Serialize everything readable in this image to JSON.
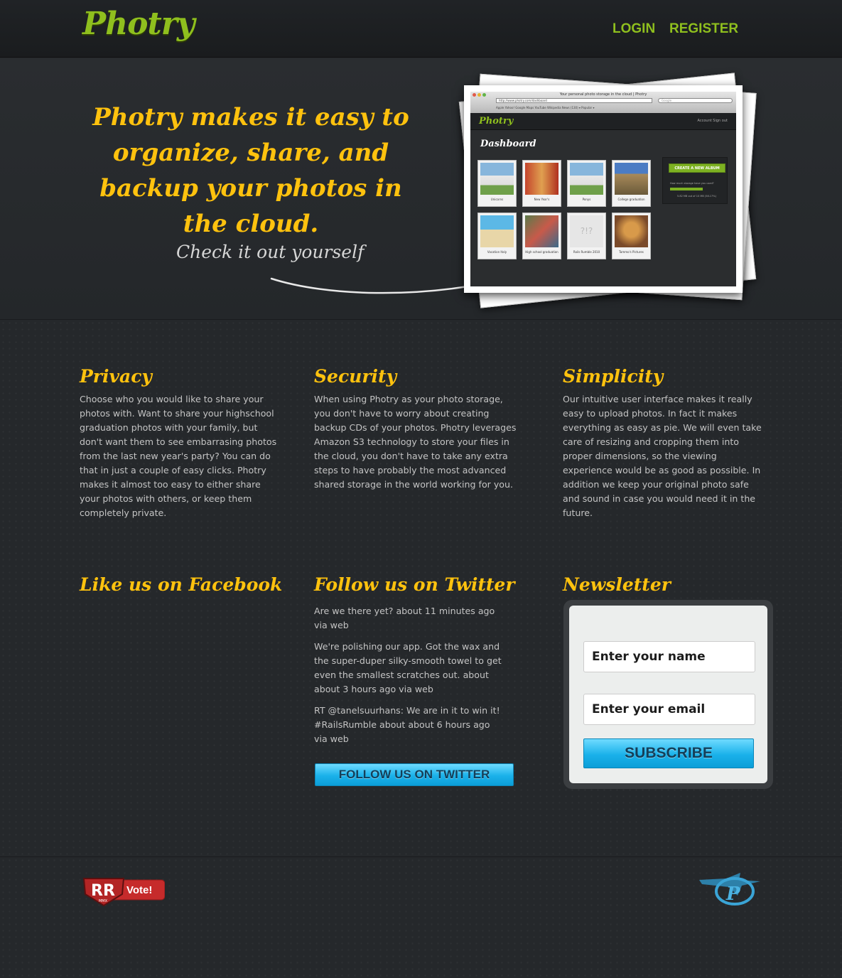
{
  "header": {
    "logo": "Photry",
    "nav": {
      "login": "LOGIN",
      "register": "REGISTER"
    }
  },
  "hero": {
    "tagline": "Photry makes it easy to organize, share, and backup your photos in the cloud.",
    "cta": "Check it out yourself",
    "screenshot": {
      "window_title": "Your personal photo storage in the cloud | Photry",
      "url": "http://www.photry.com/dashboard",
      "search_placeholder": "Google",
      "bookmarks": "Apple   Yahoo!   Google Maps   YouTube   Wikipedia   News (130) ▾   Popular ▾",
      "logo": "Photry",
      "account": "Account    Sign out",
      "heading": "Dashboard",
      "albums": [
        "Unicorns",
        "New Year's",
        "Ponys",
        "College graduation",
        "Vacation Italy",
        "High school graduation",
        "Rails Rumble 2010",
        "Tammo's Pictures"
      ],
      "create_button": "CREATE A NEW ALBUM",
      "storage_question": "How much storage have you used?",
      "storage_usage": "5.82 MB out of 10 MB (58.17%)"
    }
  },
  "features": [
    {
      "title": "Privacy",
      "text": "Choose who you would like to share your photos with. Want to share your highschool graduation photos with your family, but don't want them to see embarrasing photos from the last new year's party? You can do that in just a couple of easy clicks. Photry makes it almost too easy to either share your photos with others, or keep them completely private."
    },
    {
      "title": "Security",
      "text": "When using Photry as your photo storage, you don't have to worry about creating backup CDs of your photos. Photry leverages Amazon S3 technology to store your files in the cloud, you don't have to take any extra steps to have probably the most advanced shared storage in the world working for you."
    },
    {
      "title": "Simplicity",
      "text": "Our intuitive user interface makes it really easy to upload photos. In fact it makes everything as easy as pie. We will even take care of resizing and cropping them into proper dimensions, so the viewing experience would be as good as possible. In addition we keep your original photo safe and sound in case you would need it in the future."
    }
  ],
  "facebook": {
    "title": "Like us on Facebook"
  },
  "twitter": {
    "title": "Follow us on Twitter",
    "tweets": [
      "Are we there yet? about 11 minutes ago via web",
      "We're polishing our app. Got the wax and the super-duper silky-smooth towel to get even the smallest scratches out. about about 3 hours ago via web",
      "RT @tanelsuurhans: We are in it to win it! #RailsRumble about about 6 hours ago via web"
    ],
    "button": "FOLLOW US ON TWITTER"
  },
  "newsletter": {
    "title": "Newsletter",
    "name_placeholder": "Enter your name",
    "email_placeholder": "Enter your email",
    "button": "SUBSCRIBE"
  },
  "footer": {
    "badge_letters": "RR",
    "badge_year": "MMX",
    "vote": "Vote!"
  },
  "colors": {
    "accent_green": "#8fbf1e",
    "heading_yellow": "#ffc20e",
    "button_cyan": "#1ab1ea",
    "background": "#25282b"
  }
}
